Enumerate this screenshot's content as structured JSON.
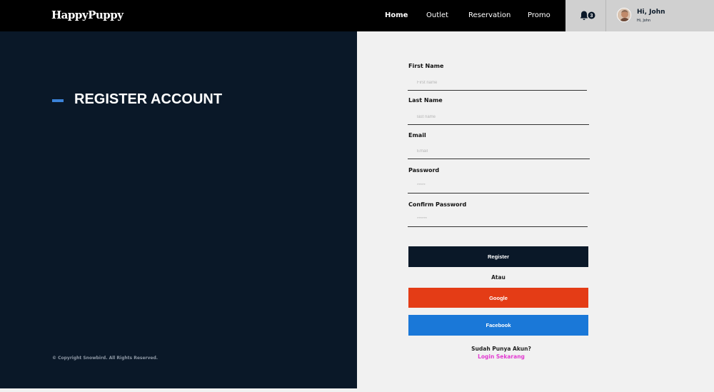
{
  "header": {
    "logo": "HappyPuppy",
    "nav": [
      "Home",
      "Outlet",
      "Reservation",
      "Promo"
    ],
    "notification_count": "3",
    "user_greeting": "Hi, John",
    "user_sub": "Hi, John"
  },
  "left": {
    "title": "REGISTER ACCOUNT",
    "copyright": "© Copyright Snowbird. All Rights Reserved."
  },
  "form": {
    "first_name_label": "First Name",
    "first_name_placeholder": "First name",
    "last_name_label": "Last Name",
    "last_name_placeholder": "last name",
    "email_label": "Email",
    "email_placeholder": "Email",
    "password_label": "Password",
    "password_placeholder": "*****",
    "confirm_label": "Confirm Password",
    "confirm_placeholder": "******",
    "register_label": "Register",
    "or_text": "Atau",
    "google_label": "Google",
    "facebook_label": "Facebook",
    "has_account_text": "Sudah Punya Akun?",
    "login_link": "Login Sekarang"
  },
  "colors": {
    "dark_navy": "#0a1828",
    "accent_blue": "#3b82d8",
    "google_red": "#e43c16",
    "facebook_blue": "#1a78d8",
    "link_magenta": "#e23bd1"
  }
}
